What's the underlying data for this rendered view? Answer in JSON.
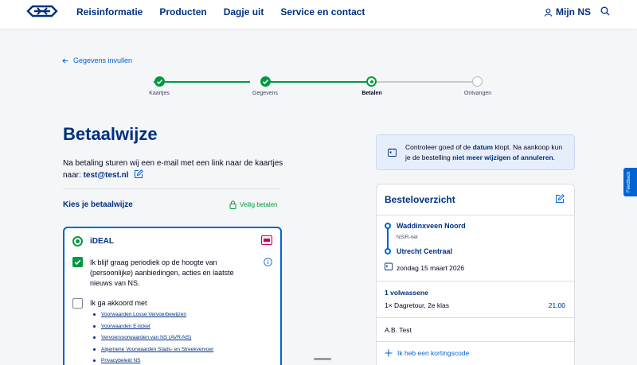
{
  "header": {
    "nav": [
      "Reisinformatie",
      "Producten",
      "Dagje uit",
      "Service en contact"
    ],
    "account_label": "Mijn NS",
    "colors": {
      "brand_blue": "#003082",
      "link_blue": "#0063d3",
      "green": "#009a42"
    }
  },
  "back_link": "Gegevens invullen",
  "stepper": {
    "steps": [
      {
        "label": "Kaartjes",
        "state": "done"
      },
      {
        "label": "Gegevens",
        "state": "done"
      },
      {
        "label": "Betalen",
        "state": "active"
      },
      {
        "label": "Ontvangen",
        "state": "todo"
      }
    ]
  },
  "page": {
    "title": "Betaalwijze",
    "lead_text": "Na betaling sturen wij een e-mail met een link naar de kaartjes naar:",
    "email": "test@test.nl",
    "choose_method": "Kies je betaalwijze",
    "secure_label": "Veilig betalen"
  },
  "payment": {
    "method_label": "iDEAL",
    "optin_text": "Ik blijf graag periodiek op de hoogte van (persoonlijke) aanbiedingen, acties en laatste nieuws van NS.",
    "agree_text": "Ik ga akkoord met",
    "terms": [
      "Voorwaarden Losse Vervoerbewijzen",
      "Voorwaarden E-ticket",
      "Vervoervoorwaarden van NS (AVR-NS)",
      "Algemene Voorwaarden Stads- en Streekvervoer",
      "Privacybeleid NS"
    ]
  },
  "notice": {
    "p1": "Controleer goed of de ",
    "b1": "datum",
    "p2": " klopt. Na aankoop kun je de bestelling ",
    "b2": "niet meer wijzigen of annuleren",
    "p3": "."
  },
  "order": {
    "title": "Besteloverzicht",
    "from": "Waddinxveen Noord",
    "network": "NS/R-net",
    "to": "Utrecht Centraal",
    "date": "zondag 15 maart 2026",
    "passengers": "1 volwassene",
    "ticket": "1× Dagretour, 2e klas",
    "price": "21,00",
    "name": "A.B. Test",
    "discount_label": "Ik heb een kortingscode"
  },
  "feedback_label": "Feedback"
}
